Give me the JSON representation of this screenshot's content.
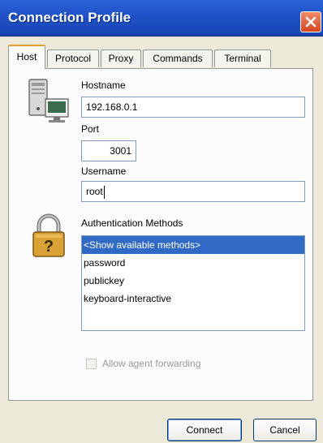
{
  "window": {
    "title": "Connection Profile",
    "close_icon": "close-icon"
  },
  "tabs": [
    {
      "label": "Host"
    },
    {
      "label": "Protocol"
    },
    {
      "label": "Proxy"
    },
    {
      "label": "Commands"
    },
    {
      "label": "Terminal"
    }
  ],
  "host": {
    "hostname_label": "Hostname",
    "hostname_value": "192.168.0.1",
    "port_label": "Port",
    "port_value": "3001",
    "username_label": "Username",
    "username_value": "root"
  },
  "auth": {
    "label": "Authentication Methods",
    "methods": [
      "<Show available methods>",
      "password",
      "publickey",
      "keyboard-interactive"
    ],
    "selected_index": 0
  },
  "agent_forwarding": {
    "label": "Allow agent forwarding",
    "checked": false,
    "enabled": false
  },
  "buttons": {
    "connect": "Connect",
    "cancel": "Cancel"
  },
  "icons": {
    "computer": "computer-icon",
    "lock": "lock-icon"
  },
  "colors": {
    "titlebar": "#2a62d8",
    "selection": "#316ac5",
    "active_tab_accent": "#e69e2d"
  }
}
